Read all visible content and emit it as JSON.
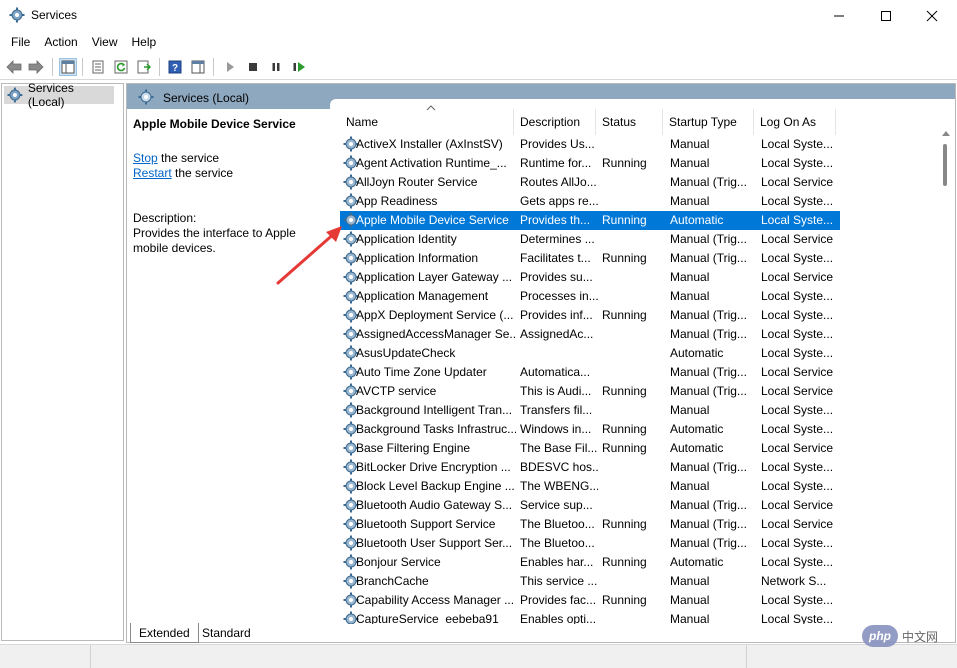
{
  "window": {
    "title": "Services",
    "minimize_glyph": "—",
    "maximize_glyph": "☐",
    "close_glyph": "✕"
  },
  "menu": [
    "File",
    "Action",
    "View",
    "Help"
  ],
  "toolbar": {
    "icons": [
      "back-icon",
      "forward-icon",
      "show-hide-console-tree-icon",
      "properties-icon",
      "refresh-icon",
      "export-list-icon",
      "help-icon",
      "show-hide-action-pane-icon",
      "start-service-icon",
      "stop-service-icon",
      "pause-service-icon",
      "restart-service-icon"
    ]
  },
  "tree": {
    "root_label": "Services (Local)"
  },
  "pane_header": {
    "label": "Services (Local)"
  },
  "description": {
    "service_name": "Apple Mobile Device Service",
    "stop_link": "Stop",
    "stop_rest": " the service",
    "restart_link": "Restart",
    "restart_rest": " the service",
    "desc_label": "Description:",
    "desc_text": "Provides the interface to Apple mobile devices."
  },
  "columns": {
    "name": "Name",
    "description": "Description",
    "status": "Status",
    "startup_type": "Startup Type",
    "log_on_as": "Log On As"
  },
  "selected_index": 4,
  "services": [
    {
      "name": "ActiveX Installer (AxInstSV)",
      "description": "Provides Us...",
      "status": "",
      "startup": "Manual",
      "logon": "Local Syste..."
    },
    {
      "name": "Agent Activation Runtime_...",
      "description": "Runtime for...",
      "status": "Running",
      "startup": "Manual",
      "logon": "Local Syste..."
    },
    {
      "name": "AllJoyn Router Service",
      "description": "Routes AllJo...",
      "status": "",
      "startup": "Manual (Trig...",
      "logon": "Local Service"
    },
    {
      "name": "App Readiness",
      "description": "Gets apps re...",
      "status": "",
      "startup": "Manual",
      "logon": "Local Syste..."
    },
    {
      "name": "Apple Mobile Device Service",
      "description": "Provides th...",
      "status": "Running",
      "startup": "Automatic",
      "logon": "Local Syste..."
    },
    {
      "name": "Application Identity",
      "description": "Determines ...",
      "status": "",
      "startup": "Manual (Trig...",
      "logon": "Local Service"
    },
    {
      "name": "Application Information",
      "description": "Facilitates t...",
      "status": "Running",
      "startup": "Manual (Trig...",
      "logon": "Local Syste..."
    },
    {
      "name": "Application Layer Gateway ...",
      "description": "Provides su...",
      "status": "",
      "startup": "Manual",
      "logon": "Local Service"
    },
    {
      "name": "Application Management",
      "description": "Processes in...",
      "status": "",
      "startup": "Manual",
      "logon": "Local Syste..."
    },
    {
      "name": "AppX Deployment Service (...",
      "description": "Provides inf...",
      "status": "Running",
      "startup": "Manual (Trig...",
      "logon": "Local Syste..."
    },
    {
      "name": "AssignedAccessManager Se...",
      "description": "AssignedAc...",
      "status": "",
      "startup": "Manual (Trig...",
      "logon": "Local Syste..."
    },
    {
      "name": "AsusUpdateCheck",
      "description": "",
      "status": "",
      "startup": "Automatic",
      "logon": "Local Syste..."
    },
    {
      "name": "Auto Time Zone Updater",
      "description": "Automatica...",
      "status": "",
      "startup": "Manual (Trig...",
      "logon": "Local Service"
    },
    {
      "name": "AVCTP service",
      "description": "This is Audi...",
      "status": "Running",
      "startup": "Manual (Trig...",
      "logon": "Local Service"
    },
    {
      "name": "Background Intelligent Tran...",
      "description": "Transfers fil...",
      "status": "",
      "startup": "Manual",
      "logon": "Local Syste..."
    },
    {
      "name": "Background Tasks Infrastruc...",
      "description": "Windows in...",
      "status": "Running",
      "startup": "Automatic",
      "logon": "Local Syste..."
    },
    {
      "name": "Base Filtering Engine",
      "description": "The Base Fil...",
      "status": "Running",
      "startup": "Automatic",
      "logon": "Local Service"
    },
    {
      "name": "BitLocker Drive Encryption ...",
      "description": "BDESVC hos...",
      "status": "",
      "startup": "Manual (Trig...",
      "logon": "Local Syste..."
    },
    {
      "name": "Block Level Backup Engine ...",
      "description": "The WBENG...",
      "status": "",
      "startup": "Manual",
      "logon": "Local Syste..."
    },
    {
      "name": "Bluetooth Audio Gateway S...",
      "description": "Service sup...",
      "status": "",
      "startup": "Manual (Trig...",
      "logon": "Local Service"
    },
    {
      "name": "Bluetooth Support Service",
      "description": "The Bluetoo...",
      "status": "Running",
      "startup": "Manual (Trig...",
      "logon": "Local Service"
    },
    {
      "name": "Bluetooth User Support Ser...",
      "description": "The Bluetoo...",
      "status": "",
      "startup": "Manual (Trig...",
      "logon": "Local Syste..."
    },
    {
      "name": "Bonjour Service",
      "description": "Enables har...",
      "status": "Running",
      "startup": "Automatic",
      "logon": "Local Syste..."
    },
    {
      "name": "BranchCache",
      "description": "This service ...",
      "status": "",
      "startup": "Manual",
      "logon": "Network S..."
    },
    {
      "name": "Capability Access Manager ...",
      "description": "Provides fac...",
      "status": "Running",
      "startup": "Manual",
      "logon": "Local Syste..."
    },
    {
      "name": "CaptureService_eebeba91",
      "description": "Enables opti...",
      "status": "",
      "startup": "Manual",
      "logon": "Local Syste..."
    }
  ],
  "tabs": [
    "Extended",
    "Standard"
  ],
  "watermark": {
    "logo": "php",
    "text": "中文网"
  },
  "colors": {
    "selection": "#0078d7",
    "pane_header": "#8ea8c0",
    "link": "#0066cc"
  }
}
